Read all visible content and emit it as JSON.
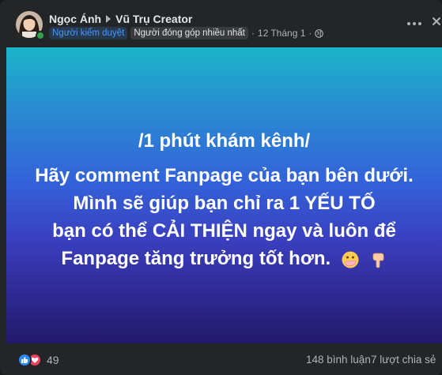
{
  "post": {
    "author_name": "Ngọc Ánh",
    "group_name": "Vũ Trụ Creator",
    "badges": [
      "Người kiểm duyệt",
      "Người đóng góp nhiều nhất"
    ],
    "date": "12 Tháng 1",
    "separator": "·",
    "privacy_icon": "globe-icon"
  },
  "image": {
    "headline": "/1 phút khám kênh/",
    "lines": [
      "Hãy comment Fanpage của bạn bên dưới.",
      "Mình sẽ giúp bạn chỉ ra 1 YẾU TỐ",
      "bạn có thể CẢI THIỆN ngay và luôn để",
      "Fanpage tăng trưởng tốt hơn."
    ],
    "emojis": [
      "face-with-hand-over-mouth",
      "backhand-index-pointing-down"
    ]
  },
  "footer": {
    "reaction_count": "49",
    "reaction_types": [
      "like",
      "love"
    ],
    "comments": "148 bình luận",
    "shares": "7 lượt chia sẻ"
  },
  "colors": {
    "background": "#242526",
    "text_primary": "#e4e6eb",
    "text_secondary": "#b0b3b8",
    "moderator_badge": "#4599ff",
    "like_blue": "#2d88ff",
    "love_red": "#f3425f"
  }
}
